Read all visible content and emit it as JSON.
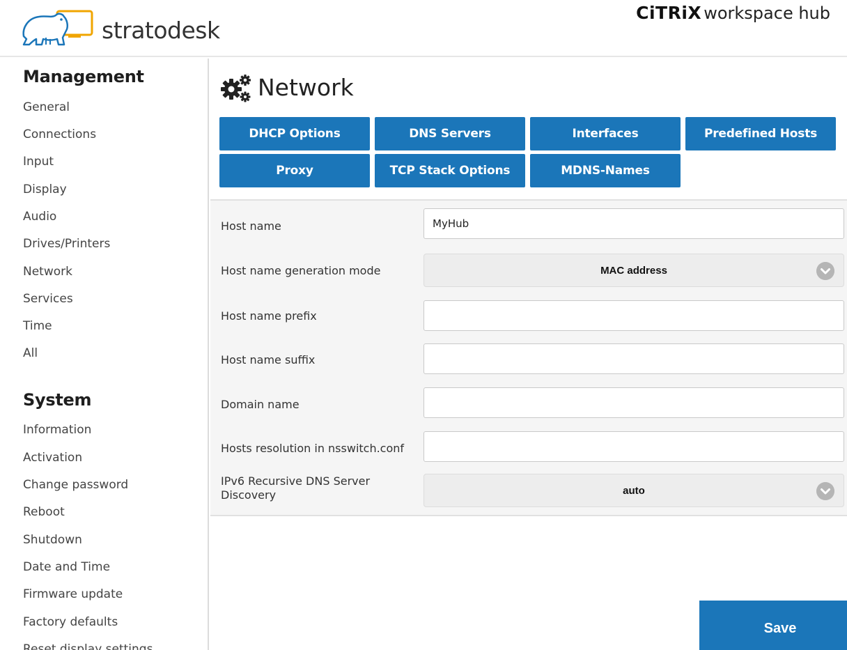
{
  "header": {
    "brand_name": "stratodesk",
    "citrix_logo_text": "CiTRiX",
    "citrix_product": "workspace hub"
  },
  "sidebar": {
    "management_heading": "Management",
    "management_items": [
      "General",
      "Connections",
      "Input",
      "Display",
      "Audio",
      "Drives/Printers",
      "Network",
      "Services",
      "Time",
      "All"
    ],
    "system_heading": "System",
    "system_items": [
      "Information",
      "Activation",
      "Change password",
      "Reboot",
      "Shutdown",
      "Date and Time",
      "Firmware update",
      "Factory defaults",
      "Reset display settings"
    ]
  },
  "main": {
    "title": "Network",
    "tabs": [
      "DHCP Options",
      "DNS Servers",
      "Interfaces",
      "Predefined Hosts",
      "Proxy",
      "TCP Stack Options",
      "MDNS-Names"
    ],
    "form": {
      "host_name_label": "Host name",
      "host_name_value": "MyHub",
      "generation_mode_label": "Host name generation mode",
      "generation_mode_value": "MAC address",
      "prefix_label": "Host name prefix",
      "prefix_value": "",
      "suffix_label": "Host name suffix",
      "suffix_value": "",
      "domain_label": "Domain name",
      "domain_value": "",
      "hosts_resolution_label": "Hosts resolution in nsswitch.conf",
      "hosts_resolution_value": "",
      "ipv6_label": "IPv6 Recursive DNS Server Discovery",
      "ipv6_value": "auto"
    },
    "save_label": "Save"
  },
  "colors": {
    "accent": "#1b76b9",
    "form_background": "#f5f5f5",
    "select_background": "#ededed"
  },
  "icons": {
    "logo": "polar-bear-monitor-icon",
    "title": "gears-icon",
    "dropdown": "chevron-down-icon"
  }
}
